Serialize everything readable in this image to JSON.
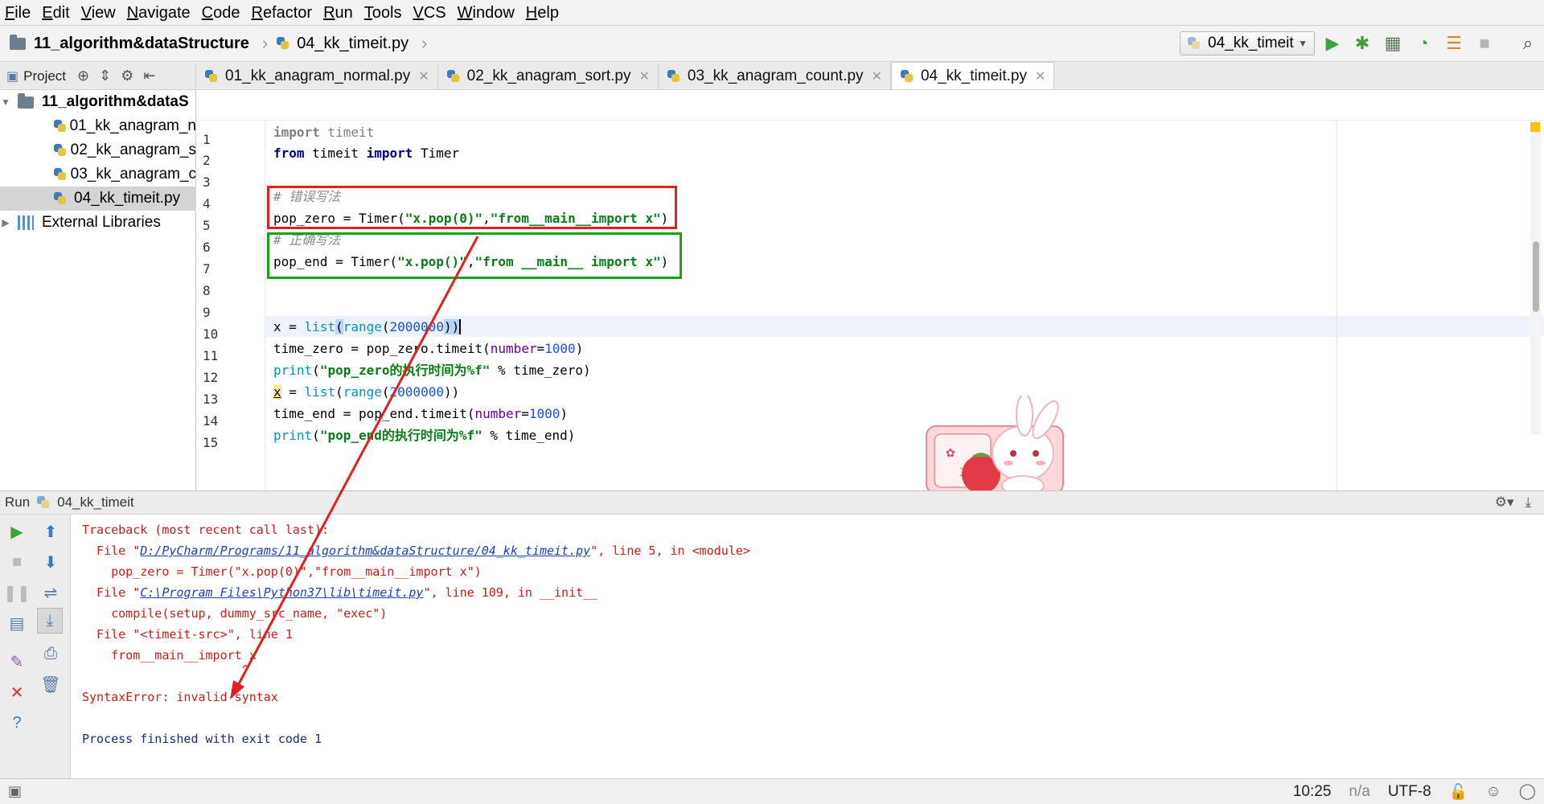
{
  "menu": [
    "File",
    "Edit",
    "View",
    "Navigate",
    "Code",
    "Refactor",
    "Run",
    "Tools",
    "VCS",
    "Window",
    "Help"
  ],
  "breadcrumb": {
    "project": "11_algorithm&dataStructure",
    "file": "04_kk_timeit.py"
  },
  "run_config": "04_kk_timeit",
  "project_tool": {
    "label": "Project"
  },
  "tabs": [
    {
      "label": "01_kk_anagram_normal.py"
    },
    {
      "label": "02_kk_anagram_sort.py"
    },
    {
      "label": "03_kk_anagram_count.py"
    },
    {
      "label": "04_kk_timeit.py"
    }
  ],
  "tree": {
    "root": "11_algorithm&dataS",
    "files": [
      "01_kk_anagram_n",
      "02_kk_anagram_s",
      "03_kk_anagram_c",
      "04_kk_timeit.py"
    ],
    "external": "External Libraries"
  },
  "line_numbers": [
    "1",
    "2",
    "3",
    "4",
    "5",
    "6",
    "7",
    "8",
    "9",
    "10",
    "11",
    "12",
    "13",
    "14",
    "15"
  ],
  "code": {
    "l1_kw": "import",
    "l1_rest": " timeit",
    "l2_kw1": "from",
    "l2_mid": " timeit ",
    "l2_kw2": "import",
    "l2_rest": " Timer",
    "l4_cmt": "# 错误写法",
    "l5_a": "pop_zero = Timer(",
    "l5_s1": "\"x.pop(0)\"",
    "l5_b": ",",
    "l5_s2": "\"from__main__import x\"",
    "l5_c": ")",
    "l6_cmt": "# 正确写法",
    "l7_a": "pop_end = Timer(",
    "l7_s1": "\"x.pop()\"",
    "l7_b": ",",
    "l7_s2": "\"from __main__ import x\"",
    "l7_c": ")",
    "l10_a": "x = ",
    "l10_b": "list",
    "l10_c": "(",
    "l10_d": "range",
    "l10_e": "(",
    "l10_f": "2000000",
    "l10_g": "))",
    "l11_a": "time_zero = pop_zero.timeit(",
    "l11_p": "number",
    "l11_eq": "=",
    "l11_n": "1000",
    "l11_c": ")",
    "l12_a": "print",
    "l12_b": "(",
    "l12_s": "\"pop_zero的执行时间为%f\"",
    "l12_c": " % time_zero)",
    "l13_x": "x",
    "l13_a": " = ",
    "l13_b": "list",
    "l13_c": "(",
    "l13_d": "range",
    "l13_e": "(",
    "l13_f": "2000000",
    "l13_g": "))",
    "l14_a": "time_end = pop_end.timeit(",
    "l14_p": "number",
    "l14_eq": "=",
    "l14_n": "1000",
    "l14_c": ")",
    "l15_a": "print",
    "l15_b": "(",
    "l15_s": "\"pop_end的执行时间为%f\"",
    "l15_c": " % time_end)"
  },
  "run_panel": {
    "label": "Run",
    "config": "04_kk_timeit"
  },
  "console": {
    "l1": "Traceback (most recent call last):",
    "l2_a": "  File \"",
    "l2_link": "D:/PyCharm/Programs/11_algorithm&dataStructure/04_kk_timeit.py",
    "l2_b": "\", line 5, in <module>",
    "l3": "    pop_zero = Timer(\"x.pop(0)\",\"from__main__import x\")",
    "l4_a": "  File \"",
    "l4_link": "C:\\Program Files\\Python37\\lib\\timeit.py",
    "l4_b": "\", line 109, in __init__",
    "l5": "    compile(setup, dummy_src_name, \"exec\")",
    "l6": "  File \"<timeit-src>\", line 1",
    "l7": "    from__main__import x",
    "l8": "                      ^",
    "l9": "SyntaxError: invalid syntax",
    "l10": "Process finished with exit code 1"
  },
  "status": {
    "position": "10:25",
    "na": "n/a",
    "encoding": "UTF-8"
  },
  "colors": {
    "red_box": "#e32020",
    "green_box": "#19a319",
    "arrow": "#e32020"
  }
}
